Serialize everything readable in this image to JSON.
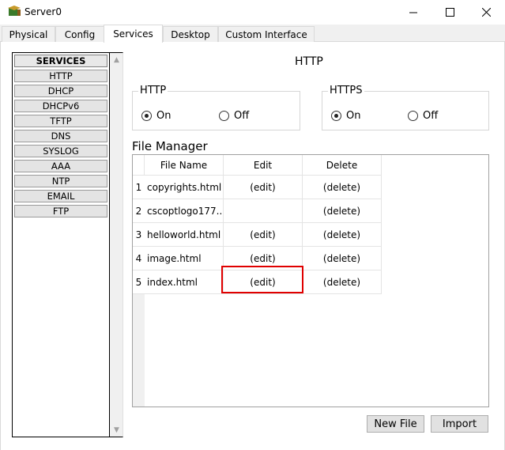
{
  "window": {
    "title": "Server0",
    "app_icon": "packet-tracer-icon"
  },
  "tabs": [
    {
      "label": "Physical"
    },
    {
      "label": "Config"
    },
    {
      "label": "Services",
      "active": true
    },
    {
      "label": "Desktop"
    },
    {
      "label": "Custom Interface"
    }
  ],
  "services": {
    "header": "SERVICES",
    "items": [
      "HTTP",
      "DHCP",
      "DHCPv6",
      "TFTP",
      "DNS",
      "SYSLOG",
      "AAA",
      "NTP",
      "EMAIL",
      "FTP"
    ]
  },
  "http_panel": {
    "title": "HTTP",
    "http_group": {
      "legend": "HTTP",
      "on_label": "On",
      "off_label": "Off",
      "selected": "On"
    },
    "https_group": {
      "legend": "HTTPS",
      "on_label": "On",
      "off_label": "Off",
      "selected": "On"
    }
  },
  "file_manager": {
    "title": "File Manager",
    "columns": [
      "File Name",
      "Edit",
      "Delete"
    ],
    "rows": [
      {
        "num": "1",
        "name": "copyrights.html",
        "edit": "(edit)",
        "delete": "(delete)"
      },
      {
        "num": "2",
        "name": "cscoptlogo177...",
        "edit": "",
        "delete": "(delete)"
      },
      {
        "num": "3",
        "name": "helloworld.html",
        "edit": "(edit)",
        "delete": "(delete)"
      },
      {
        "num": "4",
        "name": "image.html",
        "edit": "(edit)",
        "delete": "(delete)"
      },
      {
        "num": "5",
        "name": "index.html",
        "edit": "(edit)",
        "delete": "(delete)"
      }
    ],
    "new_file_label": "New File",
    "import_label": "Import"
  },
  "colors": {
    "highlight": "#e00000"
  }
}
